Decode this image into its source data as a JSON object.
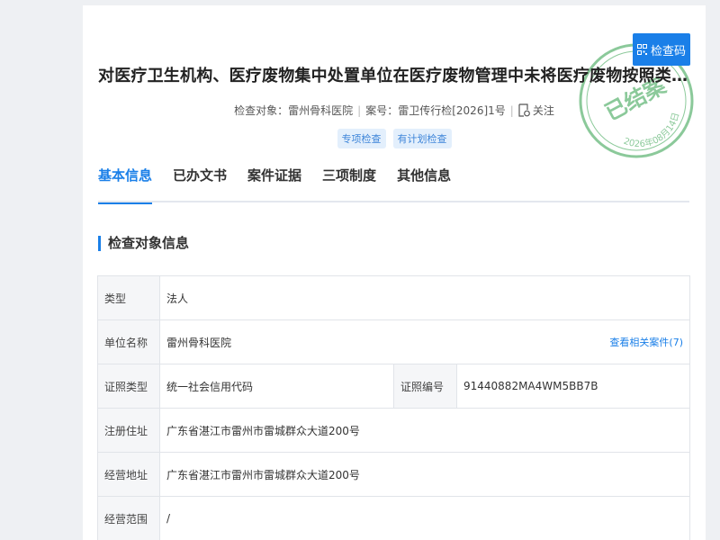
{
  "header": {
    "qr_button_label": "检查码",
    "title": "对医疗卫生机构、医疗废物集中处置单位在医疗废物管理中未将医疗废物按照类别分置于专用包装物或者...",
    "subject_label": "检查对象：",
    "subject_value": "雷州骨科医院",
    "case_label": "案号：",
    "case_value": "雷卫传行检[2026]1号",
    "follow_label": "关注",
    "tags": [
      "专项检查",
      "有计划检查"
    ]
  },
  "stamp": {
    "text": "已结案",
    "date": "2026年08月14日",
    "color": "#2e9e48"
  },
  "tabs": [
    {
      "label": "基本信息",
      "active": true
    },
    {
      "label": "已办文书"
    },
    {
      "label": "案件证据"
    },
    {
      "label": "三项制度"
    },
    {
      "label": "其他信息"
    }
  ],
  "section_title": "检查对象信息",
  "info": {
    "type_label": "类型",
    "type_value": "法人",
    "unit_label": "单位名称",
    "unit_value": "雷州骨科医院",
    "related_link": "查看相关案件(7)",
    "cert_type_label": "证照类型",
    "cert_type_value": "统一社会信用代码",
    "cert_no_label": "证照编号",
    "cert_no_value": "91440882MA4WM5BB7B",
    "reg_addr_label": "注册住址",
    "reg_addr_value": "广东省湛江市雷州市雷城群众大道200号",
    "biz_addr_label": "经营地址",
    "biz_addr_value": "广东省湛江市雷州市雷城群众大道200号",
    "scope_label": "经营范围",
    "scope_value": "/"
  }
}
